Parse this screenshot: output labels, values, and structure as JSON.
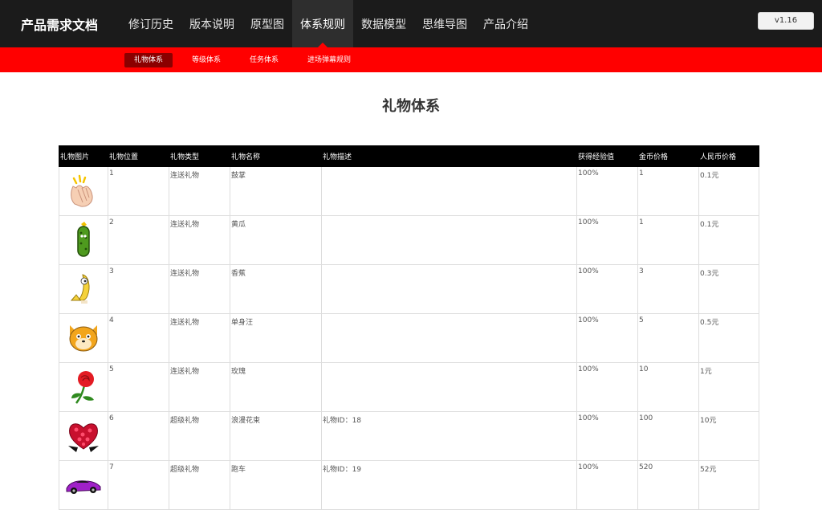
{
  "brand": "产品需求文档",
  "nav": [
    "修订历史",
    "版本说明",
    "原型图",
    "体系规则",
    "数据模型",
    "思维导图",
    "产品介绍"
  ],
  "version": "v1.16",
  "subnav": [
    "礼物体系",
    "等级体系",
    "任务体系",
    "进场弹幕规则"
  ],
  "page_title": "礼物体系",
  "table": {
    "headers": [
      "礼物图片",
      "礼物位置",
      "礼物类型",
      "礼物名称",
      "礼物描述",
      "获得经验值",
      "金币价格",
      "人民币价格"
    ],
    "rows": [
      {
        "icon": "clapping-hands-icon",
        "pos": "1",
        "type": "连送礼物",
        "name": "鼓掌",
        "desc": "",
        "exp": "100%",
        "coin": "1",
        "rmb": "0.1元"
      },
      {
        "icon": "cucumber-icon",
        "pos": "2",
        "type": "连送礼物",
        "name": "黄瓜",
        "desc": "",
        "exp": "100%",
        "coin": "1",
        "rmb": "0.1元"
      },
      {
        "icon": "banana-icon",
        "pos": "3",
        "type": "连送礼物",
        "name": "香蕉",
        "desc": "",
        "exp": "100%",
        "coin": "3",
        "rmb": "0.3元"
      },
      {
        "icon": "single-dog-icon",
        "pos": "4",
        "type": "连送礼物",
        "name": "单身汪",
        "desc": "",
        "exp": "100%",
        "coin": "5",
        "rmb": "0.5元"
      },
      {
        "icon": "rose-icon",
        "pos": "5",
        "type": "连送礼物",
        "name": "玫瑰",
        "desc": "",
        "exp": "100%",
        "coin": "10",
        "rmb": "1元"
      },
      {
        "icon": "heart-bouquet-icon",
        "pos": "6",
        "type": "超级礼物",
        "name": "浪漫花束",
        "desc": "礼物ID：18",
        "exp": "100%",
        "coin": "100",
        "rmb": "10元"
      },
      {
        "icon": "sports-car-icon",
        "pos": "7",
        "type": "超级礼物",
        "name": "跑车",
        "desc": "礼物ID：19",
        "exp": "100%",
        "coin": "520",
        "rmb": "52元"
      }
    ]
  },
  "colors": {
    "topbar": "#1b1b1b",
    "accent": "#ff0000",
    "subnav_active": "#8b0000",
    "table_header": "#000000"
  }
}
